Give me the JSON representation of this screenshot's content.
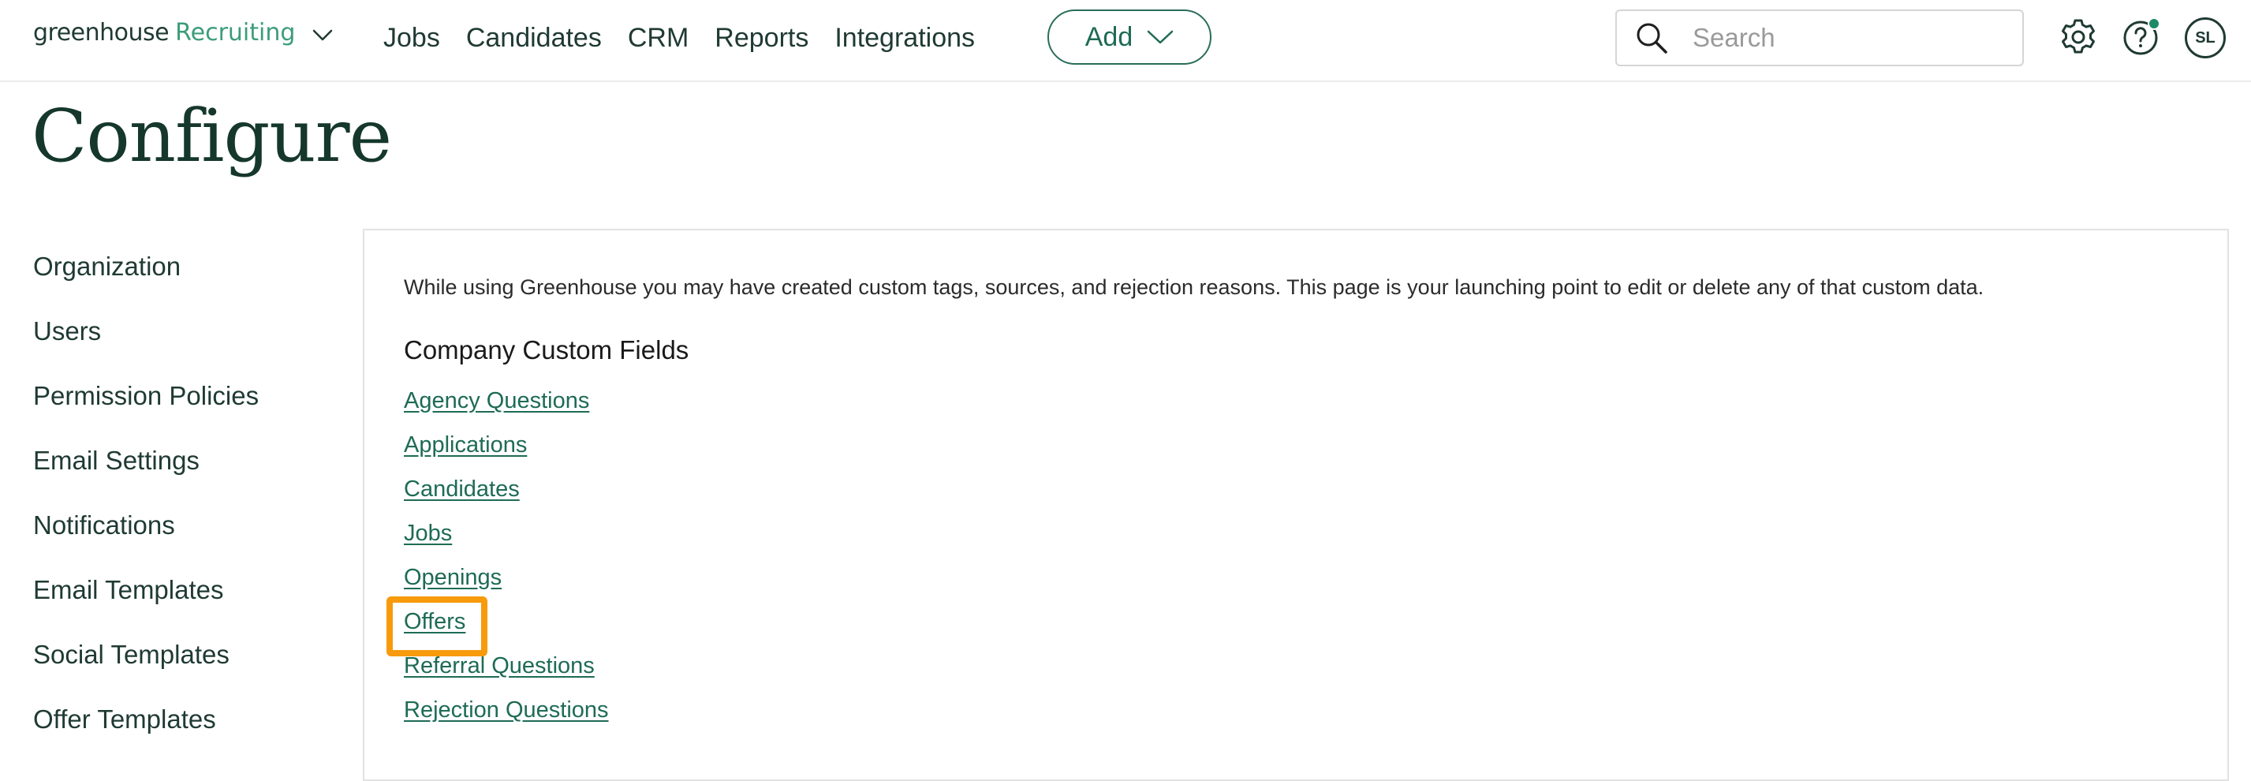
{
  "header": {
    "logo": {
      "brand": "greenhouse",
      "product": "Recruiting"
    },
    "nav": [
      "Jobs",
      "Candidates",
      "CRM",
      "Reports",
      "Integrations"
    ],
    "add_label": "Add",
    "search": {
      "placeholder": "Search",
      "value": ""
    },
    "avatar_initials": "SL",
    "icons": {
      "settings": "gear-icon",
      "help": "help-icon",
      "notification_dot_color": "#1e8a66"
    }
  },
  "page_title": "Configure",
  "sidebar": {
    "items": [
      "Organization",
      "Users",
      "Permission Policies",
      "Email Settings",
      "Notifications",
      "Email Templates",
      "Social Templates",
      "Offer Templates"
    ]
  },
  "main": {
    "intro": "While using Greenhouse you may have created custom tags, sources, and rejection reasons. This page is your launching point to edit or delete any of that custom data.",
    "section_title": "Company Custom Fields",
    "links": [
      "Agency Questions",
      "Applications",
      "Candidates",
      "Jobs",
      "Openings",
      "Offers",
      "Referral Questions",
      "Rejection Questions"
    ],
    "highlighted_link": "Offers"
  },
  "colors": {
    "brand_dark": "#1f3a33",
    "brand_green": "#3d9c7a",
    "link": "#1e6b55",
    "highlight": "#f79a0c"
  }
}
